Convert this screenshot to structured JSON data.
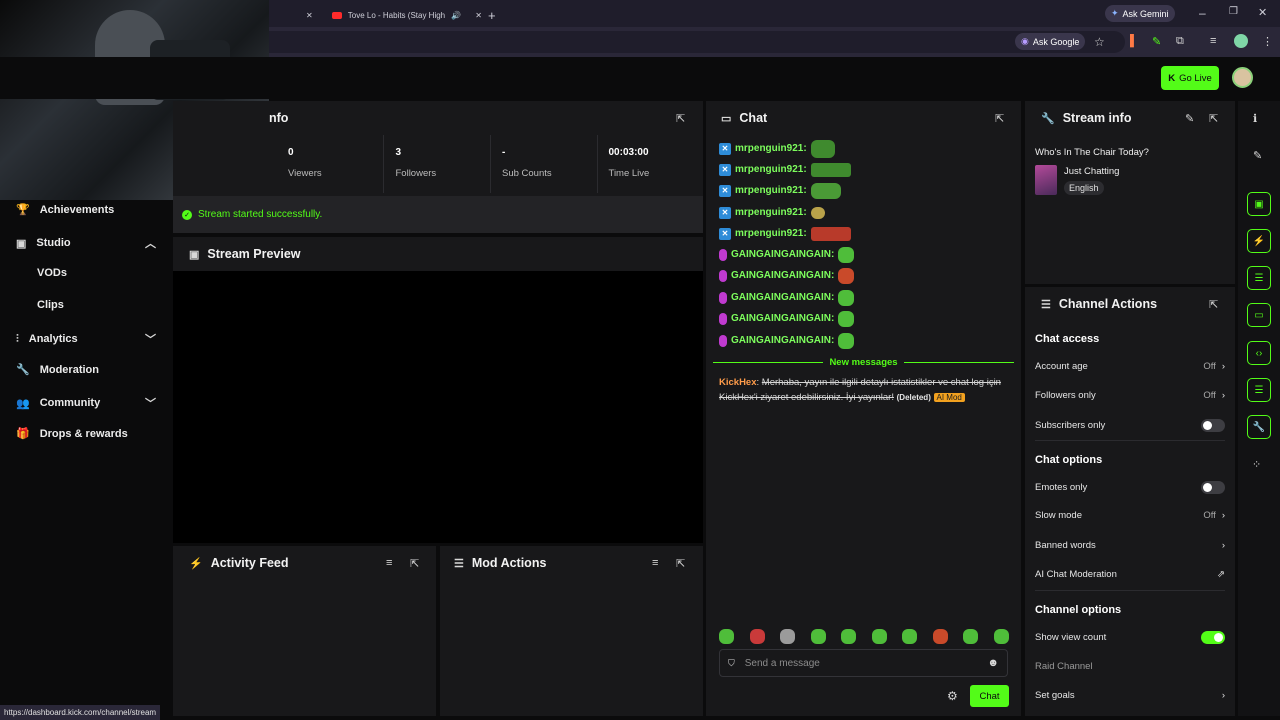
{
  "browser": {
    "tab1_label": "Tove Lo - Habits (Stay High)",
    "ask_gemini": "Ask Gemini",
    "ask_google": "Ask Google",
    "status_url": "https://dashboard.kick.com/channel/stream"
  },
  "topbar": {
    "go_live": "Go Live"
  },
  "nav": {
    "achievements": "Achievements",
    "studio": "Studio",
    "vods": "VODs",
    "clips": "Clips",
    "analytics": "Analytics",
    "moderation": "Moderation",
    "community": "Community",
    "drops": "Drops & rewards"
  },
  "session": {
    "title_partial": "nfo",
    "stats": [
      {
        "value": "0",
        "label": "Viewers"
      },
      {
        "value": "3",
        "label": "Followers"
      },
      {
        "value": "-",
        "label": "Sub Counts"
      },
      {
        "value": "00:03:00",
        "label": "Time Live"
      }
    ],
    "notice": "Stream started successfully."
  },
  "preview": {
    "title": "Stream Preview"
  },
  "activity": {
    "title": "Activity Feed"
  },
  "modactions": {
    "title": "Mod Actions"
  },
  "chat": {
    "title": "Chat",
    "messages": [
      {
        "user": "mrpenguin921:"
      },
      {
        "user": "mrpenguin921:"
      },
      {
        "user": "mrpenguin921:"
      },
      {
        "user": "mrpenguin921:"
      },
      {
        "user": "mrpenguin921:"
      },
      {
        "user": "GAINGAINGAINGAIN:"
      },
      {
        "user": "GAINGAINGAINGAIN:"
      },
      {
        "user": "GAINGAINGAINGAIN:"
      },
      {
        "user": "GAINGAINGAINGAIN:"
      },
      {
        "user": "GAINGAINGAINGAIN:"
      }
    ],
    "new_messages": "New messages",
    "deleted_msg": {
      "user": "KickHex",
      "text": "Merhaba, yayın ile ilgili detaylı istatistikler ve chat log için KickHex'i ziyaret edebilirsiniz. İyi yayınlar!",
      "deleted": "(Deleted)",
      "tag": "AI Mod"
    },
    "placeholder": "Send a message",
    "send": "Chat"
  },
  "stream_info": {
    "title": "Stream info",
    "stream_title": "Who's In The Chair Today?",
    "category": "Just Chatting",
    "language": "English"
  },
  "channel_actions": {
    "title": "Channel Actions",
    "chat_access": "Chat access",
    "account_age": "Account age",
    "followers_only": "Followers only",
    "subscribers_only": "Subscribers only",
    "off": "Off",
    "chat_options": "Chat options",
    "emotes_only": "Emotes only",
    "slow_mode": "Slow mode",
    "banned_words": "Banned words",
    "ai_chat_moderation": "AI Chat Moderation",
    "channel_options": "Channel options",
    "show_view_count": "Show view count",
    "raid_channel": "Raid Channel",
    "set_goals": "Set goals"
  },
  "colors": {
    "accent": "#53fc18",
    "panel": "#18181a",
    "bg": "#0b0b0c"
  }
}
